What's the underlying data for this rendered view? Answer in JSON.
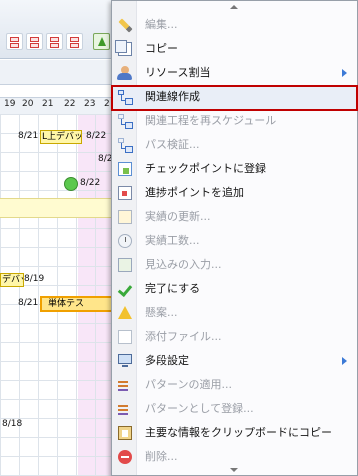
{
  "background": {
    "day_headers": [
      "19",
      "20",
      "21",
      "22",
      "23",
      "2"
    ],
    "labels": {
      "d1": "8/21",
      "task_a": "L上デバッ",
      "d2": "8/22",
      "d3": "8/22",
      "d4": "8/22",
      "task_b": "デバッ",
      "d5": "8/19",
      "d6": "8/21",
      "task_c": "単体テス",
      "d7": "8/18"
    }
  },
  "menu": {
    "items": [
      {
        "label": "編集...",
        "icon": "pencil-icon",
        "enabled": false
      },
      {
        "label": "コピー",
        "icon": "copy-icon",
        "enabled": true
      },
      {
        "label": "リソース割当",
        "icon": "user-icon",
        "enabled": true,
        "submenu": true
      },
      {
        "label": "関連線作成",
        "icon": "link-icon",
        "enabled": true,
        "highlighted": true
      },
      {
        "label": "関連工程を再スケジュール",
        "icon": "reschedule-icon",
        "enabled": false
      },
      {
        "label": "パス検証...",
        "icon": "path-icon",
        "enabled": false
      },
      {
        "label": "チェックポイントに登録",
        "icon": "checkpoint-icon",
        "enabled": true
      },
      {
        "label": "進捗ポイントを追加",
        "icon": "progress-point-icon",
        "enabled": true
      },
      {
        "label": "実績の更新...",
        "icon": "document-icon",
        "enabled": false
      },
      {
        "label": "実績工数...",
        "icon": "clock-icon",
        "enabled": false
      },
      {
        "label": "見込みの入力...",
        "icon": "input-icon",
        "enabled": false
      },
      {
        "label": "完了にする",
        "icon": "checkmark-icon",
        "enabled": true
      },
      {
        "label": "懸案...",
        "icon": "warning-icon",
        "enabled": false
      },
      {
        "label": "添付ファイル...",
        "icon": "attachment-icon",
        "enabled": false
      },
      {
        "label": "多段設定",
        "icon": "monitor-icon",
        "enabled": true,
        "submenu": true
      },
      {
        "label": "パターンの適用...",
        "icon": "pattern-apply-icon",
        "enabled": false
      },
      {
        "label": "パターンとして登録...",
        "icon": "pattern-register-icon",
        "enabled": false
      },
      {
        "label": "主要な情報をクリップボードにコピー",
        "icon": "clipboard-icon",
        "enabled": true
      },
      {
        "label": "削除...",
        "icon": "delete-icon",
        "enabled": false
      }
    ]
  }
}
